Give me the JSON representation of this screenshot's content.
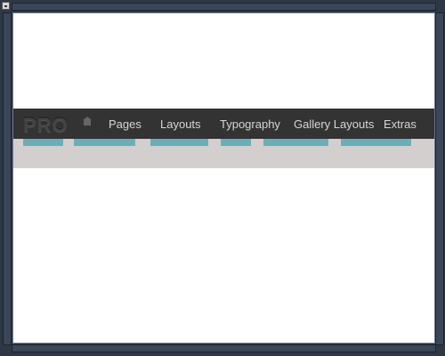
{
  "window": {
    "system_icon": "window-menu-icon"
  },
  "navbar": {
    "logo": "PRO",
    "home_icon": "home-icon",
    "items": [
      {
        "label": "Pages"
      },
      {
        "label": "Layouts"
      },
      {
        "label": "Typography"
      },
      {
        "label": "Gallery Layouts"
      },
      {
        "label": "Extras"
      }
    ]
  },
  "colors": {
    "navbar_bg": "#333333",
    "accent": "#6aaeb9",
    "subbar_bg": "#d3cfcf",
    "frame": "#2e3746"
  }
}
